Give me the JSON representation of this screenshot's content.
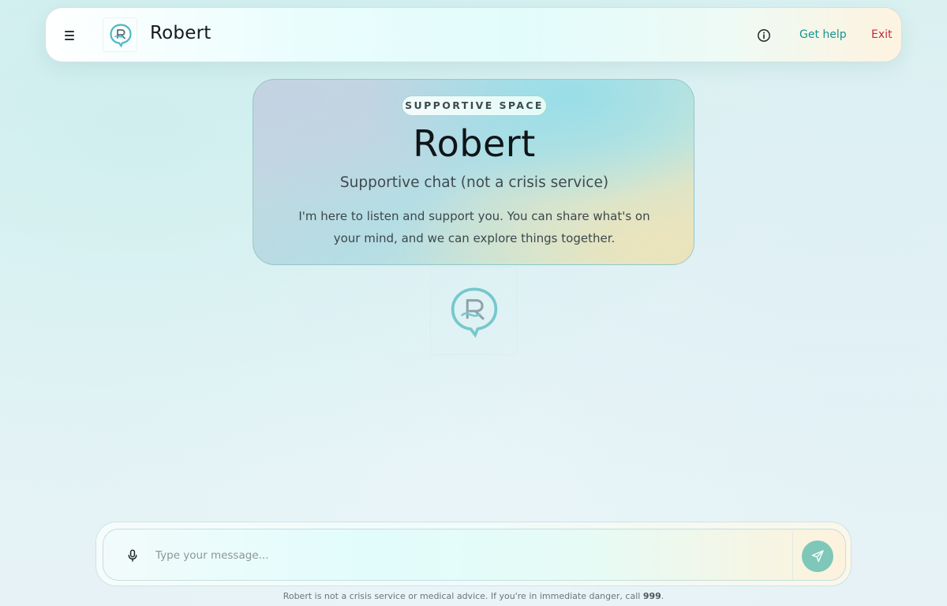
{
  "header": {
    "title": "Robert",
    "get_help_label": "Get help",
    "exit_label": "Exit",
    "icons": {
      "menu": "hamburger-menu-icon",
      "logo": "robert-logo-icon",
      "info": "info-icon"
    }
  },
  "hero": {
    "badge": "SUPPORTIVE SPACE",
    "title": "Robert",
    "subtitle": "Supportive chat (not a crisis service)",
    "body": "I'm here to listen and support you. You can share what's on your mind, and we can explore things together."
  },
  "composer": {
    "placeholder": "Type your message...",
    "value": "",
    "icons": {
      "mic": "microphone-icon",
      "send": "send-arrow-icon"
    }
  },
  "footer": {
    "disclaimer_text": "Robert is not a crisis service or medical advice. If you're in immediate danger, call ",
    "emergency_number": "999",
    "disclaimer_end": "."
  },
  "colors": {
    "accent_teal": "#169490",
    "exit_red": "#c5283b",
    "send_button": "#7ec7b9",
    "logo_teal": "#4fb8c0"
  }
}
